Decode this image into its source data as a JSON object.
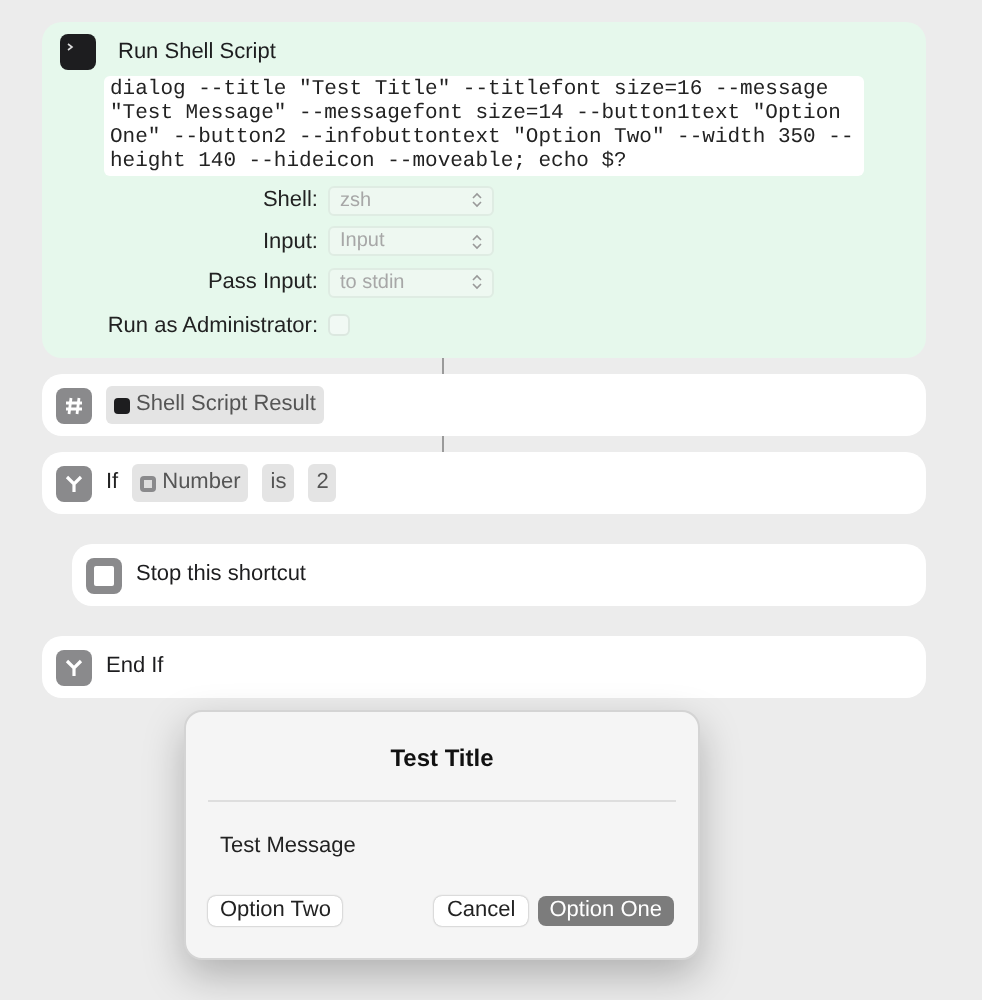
{
  "actions": [
    {
      "kind": "script",
      "title": "Run Shell Script",
      "script_lines": [
        "dialog --title \"Test Title\" --titlefont size=16 --message",
        "\"Test Message\" --messagefont size=14 --button1text \"Option",
        "One\" --button2 --infobuttontext \"Option Two\" --width 350 --",
        "height 140 --hideicon --moveable; echo $?"
      ],
      "fields": [
        {
          "label": "Shell:",
          "value": "zsh"
        },
        {
          "label": "Input:",
          "value": "Input"
        },
        {
          "label": "Pass Input:",
          "value": "to stdin"
        }
      ],
      "admin": {
        "label": "Run as Administrator:",
        "checked": false
      }
    },
    {
      "kind": "number",
      "chip": "Shell Script Result"
    },
    {
      "kind": "if",
      "word": "If",
      "variable": "Number",
      "operator": "is",
      "operand": "2"
    },
    {
      "kind": "stop",
      "title": "Stop this shortcut"
    },
    {
      "kind": "endif",
      "title": "End If"
    }
  ],
  "dialog": {
    "title": "Test Title",
    "message": "Test Message",
    "info_button": "Option Two",
    "cancel_button": "Cancel",
    "default_button": "Option One"
  }
}
